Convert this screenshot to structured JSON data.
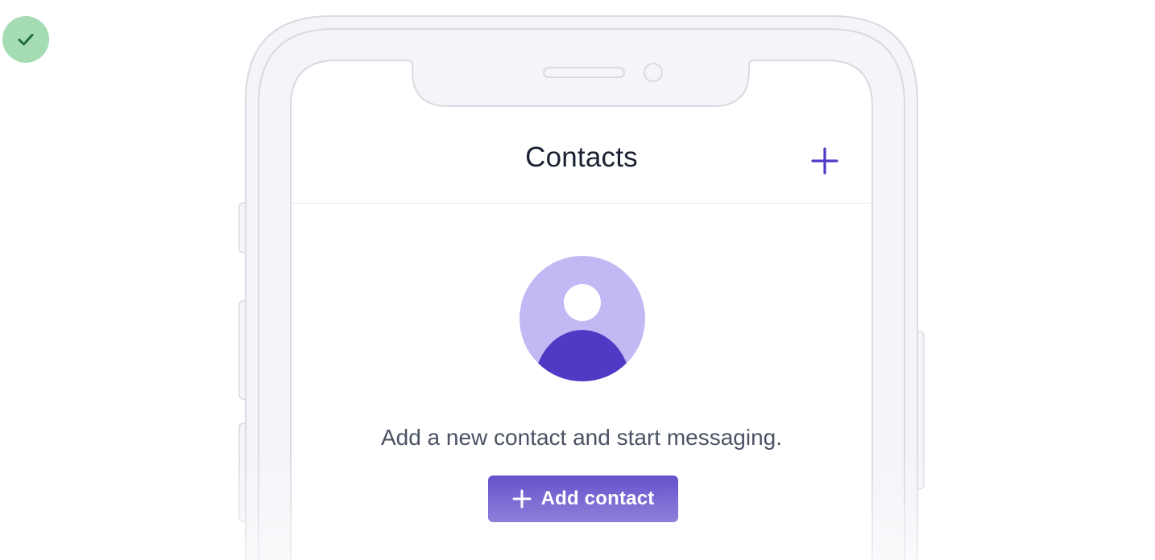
{
  "status": {
    "icon": "checkmark-icon",
    "color": "#a6dcb4",
    "icon_color": "#226d3a"
  },
  "device": {
    "type": "smartphone-mockup",
    "frame_color": "#f4f4f9",
    "outline_color": "#d9dbe2"
  },
  "header": {
    "title": "Contacts",
    "add_icon": "plus-icon",
    "accent_color": "#5139c5"
  },
  "empty_state": {
    "avatar_icon": "person-avatar-icon",
    "avatar_bg": "#c2b8f4",
    "avatar_body": "#5139c5",
    "message": "Add a new contact and start messaging."
  },
  "actions": {
    "add_contact_label": "Add contact",
    "add_contact_icon": "plus-icon"
  }
}
